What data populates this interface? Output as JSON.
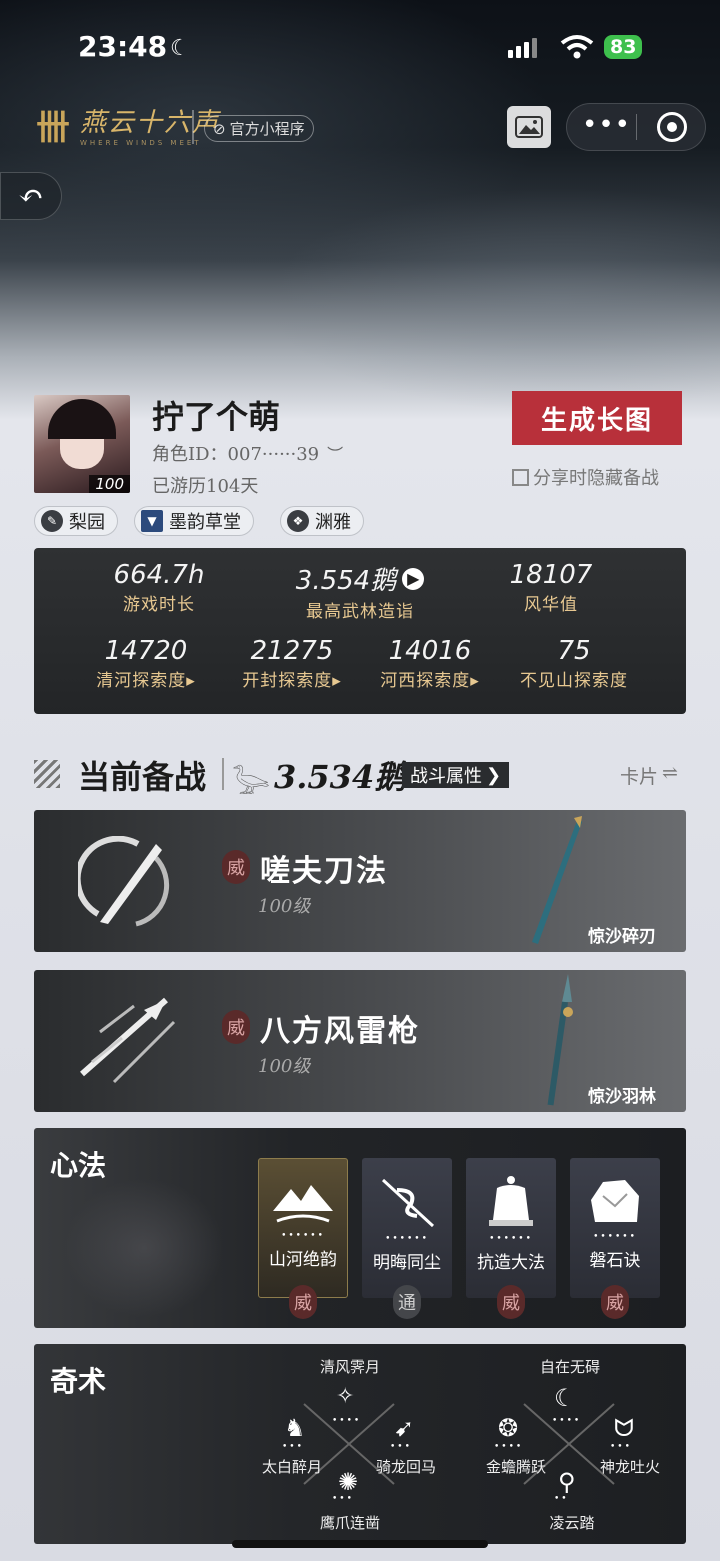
{
  "status_bar": {
    "time": "23:48",
    "battery": "83"
  },
  "mini_program": {
    "logo_text": "燕云十六声",
    "logo_sub": "WHERE WINDS MEET",
    "badge": "官方小程序"
  },
  "profile": {
    "name": "拧了个萌",
    "role_id": "角色ID：007······39",
    "days": "已游历104天",
    "level": "100",
    "generate_button": "生成长图",
    "hide_option": "分享时隐藏备战",
    "tags": [
      "梨园",
      "墨韵草堂",
      "渊雅"
    ]
  },
  "stats": [
    {
      "value": "664.7h",
      "label": "游戏时长"
    },
    {
      "value": "3.554鹅",
      "label": "最高武林造诣"
    },
    {
      "value": "18107",
      "label": "风华值"
    },
    {
      "value": "14720",
      "label": "清河探索度"
    },
    {
      "value": "21275",
      "label": "开封探索度"
    },
    {
      "value": "14016",
      "label": "河西探索度"
    },
    {
      "value": "75",
      "label": "不见山探索度"
    }
  ],
  "battle": {
    "title": "当前备战",
    "score": "3.534鹅",
    "attr_button": "战斗属性",
    "switch_label": "卡片"
  },
  "weapons": [
    {
      "seal": "威",
      "name": "嗟夫刀法",
      "level": "100级",
      "item": "惊沙碎刃"
    },
    {
      "seal": "威",
      "name": "八方风雷枪",
      "level": "100级",
      "item": "惊沙羽林"
    }
  ],
  "xinfa": {
    "title": "心法",
    "items": [
      {
        "name": "山河绝韵",
        "seal": "威"
      },
      {
        "name": "明晦同尘",
        "seal": "通"
      },
      {
        "name": "抗造大法",
        "seal": "威"
      },
      {
        "name": "磐石诀",
        "seal": "威"
      }
    ]
  },
  "qishu": {
    "title": "奇术",
    "group1": {
      "top": "清风霁月",
      "left": "太白醉月",
      "right": "骑龙回马",
      "bottom": "鹰爪连凿"
    },
    "group2": {
      "top": "自在无碍",
      "left": "金蟾腾跃",
      "right": "神龙吐火",
      "bottom": "凌云踏"
    }
  },
  "colors": {
    "accent_red": "#b8303a",
    "gold": "#e7c891",
    "battery_green": "#3ec04d"
  }
}
